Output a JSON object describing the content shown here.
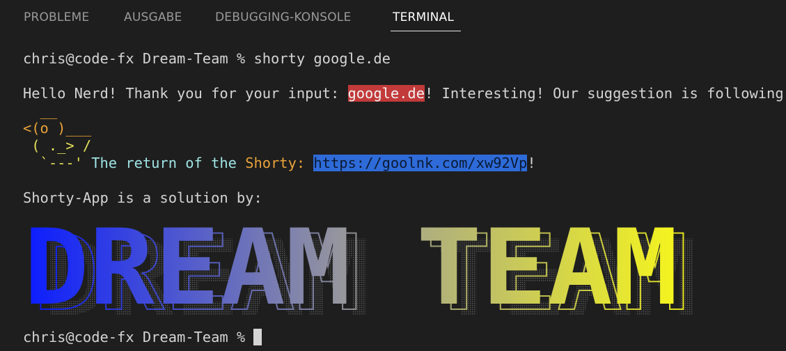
{
  "tabs": [
    {
      "label": "PROBLEME",
      "active": false
    },
    {
      "label": "AUSGABE",
      "active": false
    },
    {
      "label": "DEBUGGING-KONSOLE",
      "active": false
    },
    {
      "label": "TERMINAL",
      "active": true
    }
  ],
  "terminal": {
    "prompt": "chris@code-fx Dream-Team % ",
    "command": "shorty google.de",
    "hello_prefix": "Hello Nerd! Thank you for your input: ",
    "hello_input": "google.de",
    "hello_suffix": "! Interesting! Our suggestion is following!",
    "duck": {
      "line1": "  __",
      "line2": "<(o )___",
      "line3": " ( ._> /",
      "line4_art": "  `---' ",
      "line4_text_a": "The return of the ",
      "line4_text_b": "Shorty:",
      "line4_url": "https://goolnk.com/xw92Vp",
      "line4_end": "!"
    },
    "solution_line": "Shorty-App is a solution by:",
    "banner_text": "DREAM TEAM",
    "final_prompt": "chris@code-fx Dream-Team % "
  },
  "colors": {
    "background": "#1e1e1e",
    "text": "#d4d4d4",
    "highlight_red": "#c23a3a",
    "highlight_blue": "#2e6bd8",
    "duck_orange": "#e8a23a",
    "banner_start": "#0a1cff",
    "banner_end": "#f5f51e"
  }
}
